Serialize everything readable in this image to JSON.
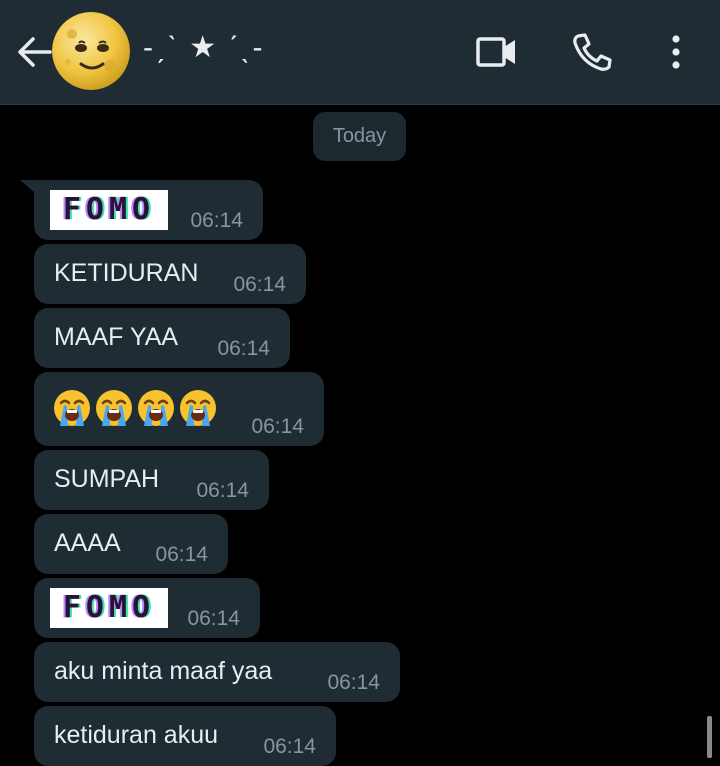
{
  "header": {
    "contact_name": "-ˏˋ ★ ˊˎ-",
    "avatar_icon": "moon-face-emoji",
    "back_icon": "arrow-left-icon",
    "video_icon": "video-camera-icon",
    "call_icon": "phone-icon",
    "menu_icon": "more-vertical-icon",
    "background": "#1f2c34"
  },
  "chat": {
    "date_chip": "Today",
    "messages": [
      {
        "type": "sticker",
        "text": "FOMO",
        "time": "06:14"
      },
      {
        "type": "text",
        "text": "KETIDURAN",
        "time": "06:14"
      },
      {
        "type": "text",
        "text": "MAAF YAA",
        "time": "06:14"
      },
      {
        "type": "emoji",
        "emoji": "😭😭😭😭",
        "emoji_icon": "loudly-crying-face-emoji",
        "count": 4,
        "time": "06:14"
      },
      {
        "type": "text",
        "text": "SUMPAH",
        "time": "06:14"
      },
      {
        "type": "text",
        "text": "AAAA",
        "time": "06:14"
      },
      {
        "type": "sticker",
        "text": "FOMO",
        "time": "06:14"
      },
      {
        "type": "text",
        "text": "aku minta maaf yaa",
        "time": "06:14"
      },
      {
        "type": "text",
        "text": "ketiduran akuu",
        "time": "06:14"
      }
    ]
  },
  "colors": {
    "background": "#000000",
    "bubble": "#1f2c34",
    "text": "#e9edef",
    "meta_text": "#8696a0"
  }
}
